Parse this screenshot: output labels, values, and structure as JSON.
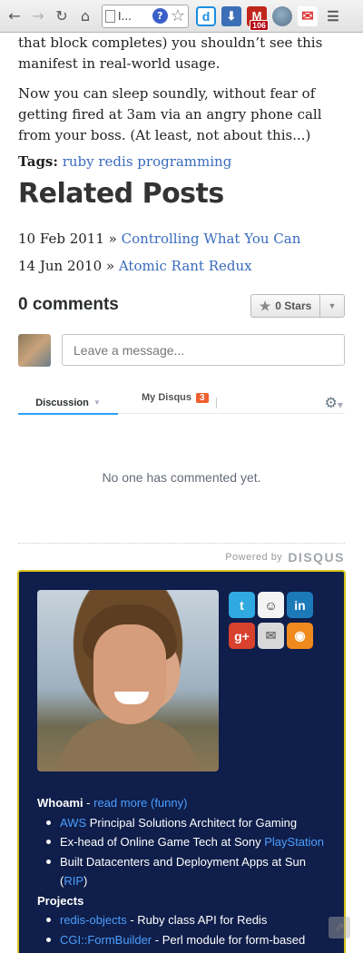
{
  "browser": {
    "tab_title": "I...",
    "help_label": "?",
    "ext_d": "d",
    "ext_download": "⬇",
    "gmail_badge": "106",
    "ext_gmail": "M"
  },
  "article": {
    "paragraph1": "that block completes) you shouldn’t see this manifest in real-world usage.",
    "paragraph2": "Now you can sleep soundly, without fear of getting fired at 3am via an angry phone call from your boss. (At least, not about this...)",
    "tags_label": "Tags:",
    "tags": "ruby redis programming"
  },
  "related": {
    "title": "Related Posts",
    "posts": [
      {
        "date": "10 Feb 2011 »",
        "title": "Controlling What You Can"
      },
      {
        "date": "14 Jun 2010 »",
        "title": "Atomic Rant Redux"
      }
    ]
  },
  "disqus": {
    "comments_count": "0 comments",
    "stars_label": "0 Stars",
    "input_placeholder": "Leave a message...",
    "tab_discussion": "Discussion",
    "tab_my_disqus": "My Disqus",
    "my_disqus_count": "3",
    "empty_text": "No one has commented yet.",
    "powered_by": "Powered by",
    "brand": "DISQUS"
  },
  "about": {
    "social": [
      "twitter-icon",
      "github-icon",
      "linkedin-icon",
      "google-plus-icon",
      "email-icon",
      "rss-icon"
    ],
    "whoami_label": "Whoami",
    "whoami_sep": " - ",
    "read_more": "read more (funny)",
    "item1_link": "AWS",
    "item1_text": " Principal Solutions Architect for Gaming",
    "item2_text": "Ex-head of Online Game Tech at Sony ",
    "item2_link": "PlayStation",
    "item3_text": "Built Datacenters and Deployment Apps at Sun (",
    "item3_link": "RIP",
    "item3_end": ")",
    "projects_label": "Projects",
    "proj1_link": "redis-objects",
    "proj1_text": " - Ruby class API for Redis",
    "proj2_link": "CGI::FormBuilder",
    "proj2_text": " - Perl module for form-based"
  },
  "colors": {
    "link": "#3a6bbd",
    "about_bg": "#0f1e4a",
    "about_border": "#d6c21b",
    "disqus_accent": "#2e9fff",
    "badge": "#f05f2f"
  }
}
